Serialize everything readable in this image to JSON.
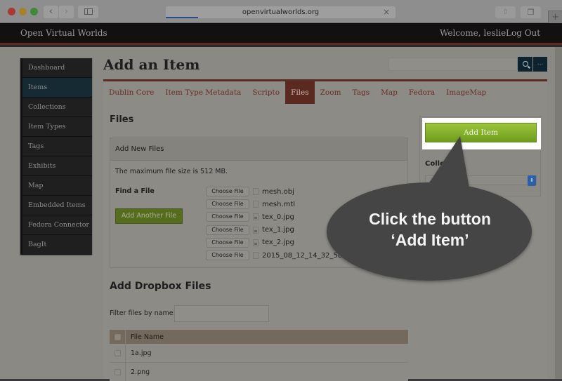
{
  "browser": {
    "url": "openvirtualworlds.org",
    "back_glyph": "‹",
    "forward_glyph": "›",
    "close_glyph": "×",
    "share_glyph": "⇧",
    "tabs_glyph": "❐",
    "newtab_glyph": "+"
  },
  "header": {
    "site_title": "Open Virtual Worlds",
    "welcome_prefix": "Welcome,",
    "username": "leslie",
    "logout_label": "Log Out"
  },
  "sidebar": {
    "items": [
      {
        "label": "Dashboard",
        "active": false
      },
      {
        "label": "Items",
        "active": true
      },
      {
        "label": "Collections",
        "active": false
      },
      {
        "label": "Item Types",
        "active": false
      },
      {
        "label": "Tags",
        "active": false
      },
      {
        "label": "Exhibits",
        "active": false
      },
      {
        "label": "Map",
        "active": false
      },
      {
        "label": "Embedded Items",
        "active": false
      },
      {
        "label": "Fedora Connector",
        "active": false
      },
      {
        "label": "BagIt",
        "active": false
      }
    ]
  },
  "page": {
    "title": "Add an Item",
    "search": {
      "value": "",
      "placeholder": "",
      "more_label": "..."
    }
  },
  "tabs": [
    {
      "label": "Dublin Core",
      "active": false
    },
    {
      "label": "Item Type Metadata",
      "active": false
    },
    {
      "label": "Scripto",
      "active": false
    },
    {
      "label": "Files",
      "active": true
    },
    {
      "label": "Zoom",
      "active": false
    },
    {
      "label": "Tags",
      "active": false
    },
    {
      "label": "Map",
      "active": false
    },
    {
      "label": "Fedora",
      "active": false
    },
    {
      "label": "ImageMap",
      "active": false
    }
  ],
  "files": {
    "heading": "Files",
    "box_title": "Add New Files",
    "max_size_text": "The maximum file size is 512 MB.",
    "find_label": "Find a File",
    "choose_label": "Choose File",
    "add_another_label": "Add Another File",
    "selected": [
      {
        "name": "mesh.obj",
        "icon": "document-icon"
      },
      {
        "name": "mesh.mtl",
        "icon": "document-icon"
      },
      {
        "name": "tex_0.jpg",
        "icon": "image-file-icon"
      },
      {
        "name": "tex_1.jpg",
        "icon": "image-file-icon"
      },
      {
        "name": "tex_2.jpg",
        "icon": "image-file-icon"
      },
      {
        "name": "2015_08_12_14_32_58...",
        "icon": "document-icon"
      }
    ]
  },
  "save_panel": {
    "add_item_label": "Add Item",
    "collection_label": "Collection",
    "collection_value": ""
  },
  "dropbox": {
    "heading": "Add Dropbox Files",
    "filter_label": "Filter files by name:",
    "filter_value": "",
    "column_header": "File Name",
    "rows": [
      {
        "name": "1a.jpg"
      },
      {
        "name": "2.png"
      }
    ]
  },
  "callout": {
    "line1": "Click the button",
    "line2": "‘Add Item’",
    "fill": "#454545"
  }
}
